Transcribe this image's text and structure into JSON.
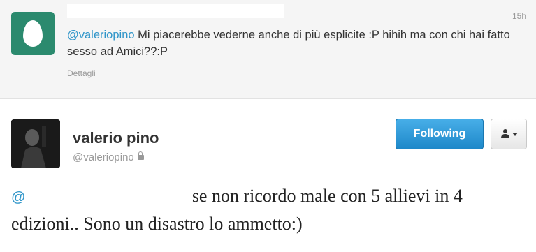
{
  "reply": {
    "time": "15h",
    "mention": "@valeriopino",
    "text": " Mi piacerebbe vederne anche di più esplicite :P hihih ma con chi hai fatto sesso ad Amici??:P",
    "details": "Dettagli",
    "avatar_icon": "egg-icon",
    "avatar_color": "#2b8a6e"
  },
  "tweet": {
    "user_name": "valerio pino",
    "user_handle": "@valeriopino",
    "follow_label": "Following",
    "text_mention": "@",
    "text_body": "se non ricordo male con 5 allievi in 4 edizioni.. Sono un disastro lo ammetto:)"
  },
  "colors": {
    "link": "#2f95c9",
    "follow_button": "#1e88c9"
  }
}
